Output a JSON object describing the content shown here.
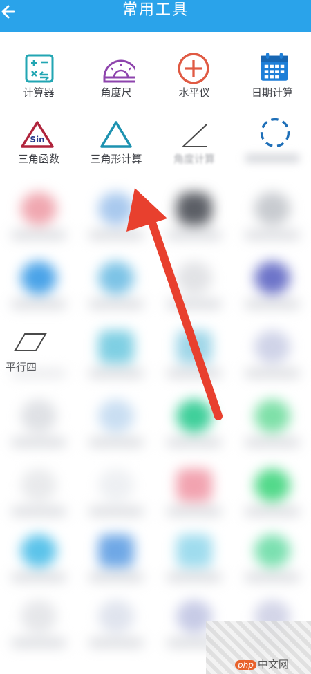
{
  "header": {
    "title": "常用工具",
    "back_icon": "arrow-left-icon"
  },
  "tools": [
    {
      "label": "计算器",
      "icon": "calculator-icon",
      "color": "#22a6b3"
    },
    {
      "label": "角度尺",
      "icon": "protractor-icon",
      "color": "#8e44ad"
    },
    {
      "label": "水平仪",
      "icon": "level-icon",
      "color": "#e05a43"
    },
    {
      "label": "日期计算",
      "icon": "calendar-icon",
      "color": "#1e7fd8"
    },
    {
      "label": "三角函数",
      "icon": "sin-triangle-icon",
      "color": "#b0243c"
    },
    {
      "label": "三角形计算",
      "icon": "triangle-icon",
      "color": "#1d92b0"
    },
    {
      "label": "角度计算",
      "icon": "angle-icon",
      "color": "#4a4a4a"
    }
  ],
  "partial_labels": {
    "parallelogram": "平行四"
  },
  "watermark": {
    "brand": "php",
    "site": "中文网"
  }
}
